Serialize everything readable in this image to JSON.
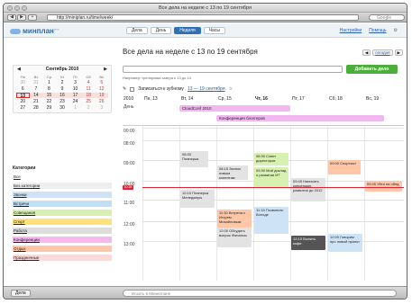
{
  "window": {
    "title": "Все дела на неделе с 13 по 19 сентября"
  },
  "browser": {
    "url": "http://miniplan.ru/time/week/",
    "search_placeholder": "Google"
  },
  "app": {
    "logo": "минплан",
    "logo_sup": "beta",
    "tabs": [
      {
        "label": "Дела"
      },
      {
        "label": "День"
      },
      {
        "label": "Неделя"
      },
      {
        "label": "Часы"
      }
    ],
    "links": {
      "settings": "Настройки",
      "help": "Помощь"
    }
  },
  "minical": {
    "month": "Сентябрь 2010",
    "weekdays": [
      "Пн",
      "Вт",
      "Ср",
      "Чт",
      "Пт",
      "Сб",
      "Вс"
    ],
    "days": [
      "30",
      "31",
      "1",
      "2",
      "3",
      "4",
      "5",
      "6",
      "7",
      "8",
      "9",
      "10",
      "11",
      "12",
      "13",
      "14",
      "15",
      "16",
      "17",
      "18",
      "19",
      "20",
      "21",
      "22",
      "23",
      "24",
      "25",
      "26",
      "27",
      "28",
      "29",
      "30",
      "1",
      "2",
      "3"
    ]
  },
  "categories": {
    "header": "Категории",
    "items": [
      {
        "label": "Все",
        "color": "#ffffff"
      },
      {
        "label": "Без категории",
        "color": "#eeeeee"
      },
      {
        "label": "Звонки",
        "color": "#cfe3f7"
      },
      {
        "label": "Встречи",
        "color": "#bde0f5"
      },
      {
        "label": "Совещания",
        "color": "#d8f0b0"
      },
      {
        "label": "Спорт",
        "color": "#ffe27a"
      },
      {
        "label": "Работа",
        "color": "#dddddd"
      },
      {
        "label": "Конференции",
        "color": "#f7b8f0"
      },
      {
        "label": "Отдых",
        "color": "#ffc7a8"
      },
      {
        "label": "Праздничные",
        "color": "#ffd8d8"
      }
    ]
  },
  "main": {
    "title": "Все дела на неделе с 13 по 19 сентября",
    "prev": "◀",
    "current": "сегодня",
    "next": "▶",
    "add_button": "Добавить дело",
    "hint": "Например: тренировка завтра с 13 до 14",
    "task_title": "Записаться к зубному",
    "task_range": "13 — 19 сентября"
  },
  "calendar": {
    "day_heads": [
      "2010",
      "Пн, 13",
      "Вт, 14",
      "Ср, 15",
      "Чт, 16",
      "Пт, 17",
      "Сб, 18",
      "Вс, 19"
    ],
    "allday_label": "День",
    "hours": [
      "08:00",
      "09:00",
      "10:00",
      "11:00",
      "12:00",
      "13:00"
    ],
    "pre_hour": "00:00",
    "now": "10:25",
    "allday_events": [
      {
        "text": "CloudConf 2010",
        "color": "#f1b8f0"
      },
      {
        "text": "Конференция блоггеров",
        "color": "#f1b8f0"
      }
    ],
    "events": [
      {
        "text": "08:30 Планерка",
        "color": "#e3e3e3"
      },
      {
        "text": "08:15 Звонок новым клиентам",
        "color": "#e3e3e3"
      },
      {
        "text": "08:30 Совет директоров",
        "color": "#d8f0b0"
      },
      {
        "text": "09:30 Мой доклад о развитии ИТ",
        "color": "#d8f0b0"
      },
      {
        "text": "09:00 Спортзал",
        "color": "#ffc7a8"
      },
      {
        "text": "09:45 Написать концепцию развития до 2012",
        "color": "#e3e3e3"
      },
      {
        "text": "09:45 Уйти на обед",
        "color": "#ffc7a8"
      },
      {
        "text": "10:15 Планерка Менеджеры",
        "color": "#e3e3e3"
      },
      {
        "text": "11:30 Встреча с Игорем Михайловым",
        "color": "#ffc7a8"
      },
      {
        "text": "11:15 Позвонить Володе",
        "color": "#cfe3f7"
      },
      {
        "text": "12:00 Обсудить вопрос Финансы",
        "color": "#e3e3e3"
      },
      {
        "text": "12:15 Выпить кофе",
        "color": "#555555"
      },
      {
        "text": "12:00 Говорим про новый проект",
        "color": "#cfe3f7"
      }
    ]
  },
  "bottom": {
    "tasks": "Дела",
    "search_placeholder": "Искать в Миниплане"
  }
}
